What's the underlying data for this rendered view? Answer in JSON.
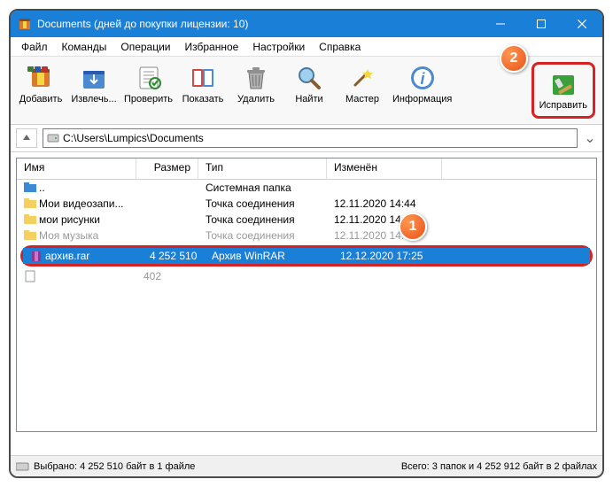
{
  "title": "Documents (дней до покупки лицензии: 10)",
  "menu": [
    "Файл",
    "Команды",
    "Операции",
    "Избранное",
    "Настройки",
    "Справка"
  ],
  "toolbar": {
    "add": "Добавить",
    "extract": "Извлечь...",
    "test": "Проверить",
    "view": "Показать",
    "delete": "Удалить",
    "find": "Найти",
    "wizard": "Мастер",
    "info": "Информация",
    "repair": "Исправить"
  },
  "path": "C:\\Users\\Lumpics\\Documents",
  "columns": {
    "name": "Имя",
    "size": "Размер",
    "type": "Тип",
    "modified": "Изменён"
  },
  "rows": [
    {
      "icon": "folder-up",
      "name": "..",
      "size": "",
      "type": "Системная папка",
      "modified": ""
    },
    {
      "icon": "folder",
      "name": "Мои видеозапи...",
      "size": "",
      "type": "Точка соединения",
      "modified": "12.11.2020 14:44"
    },
    {
      "icon": "folder",
      "name": "мои рисунки",
      "size": "",
      "type": "Точка соединения",
      "modified": "12.11.2020 14:44"
    },
    {
      "icon": "folder",
      "name": "Моя музыка",
      "size": "",
      "type": "Точка соединения",
      "modified": "12.11.2020 14:44"
    },
    {
      "icon": "rar",
      "name": "архив.rar",
      "size": "4 252 510",
      "type": "Архив WinRAR",
      "modified": "12.12.2020 17:25",
      "selected": true
    },
    {
      "icon": "file",
      "name": "",
      "size": "402",
      "type": "",
      "modified": ""
    }
  ],
  "status": {
    "left": "Выбрано: 4 252 510 байт в 1 файле",
    "right": "Всего: 3 папок и 4 252 912 байт в 2 файлах"
  },
  "badges": {
    "one": "1",
    "two": "2"
  }
}
